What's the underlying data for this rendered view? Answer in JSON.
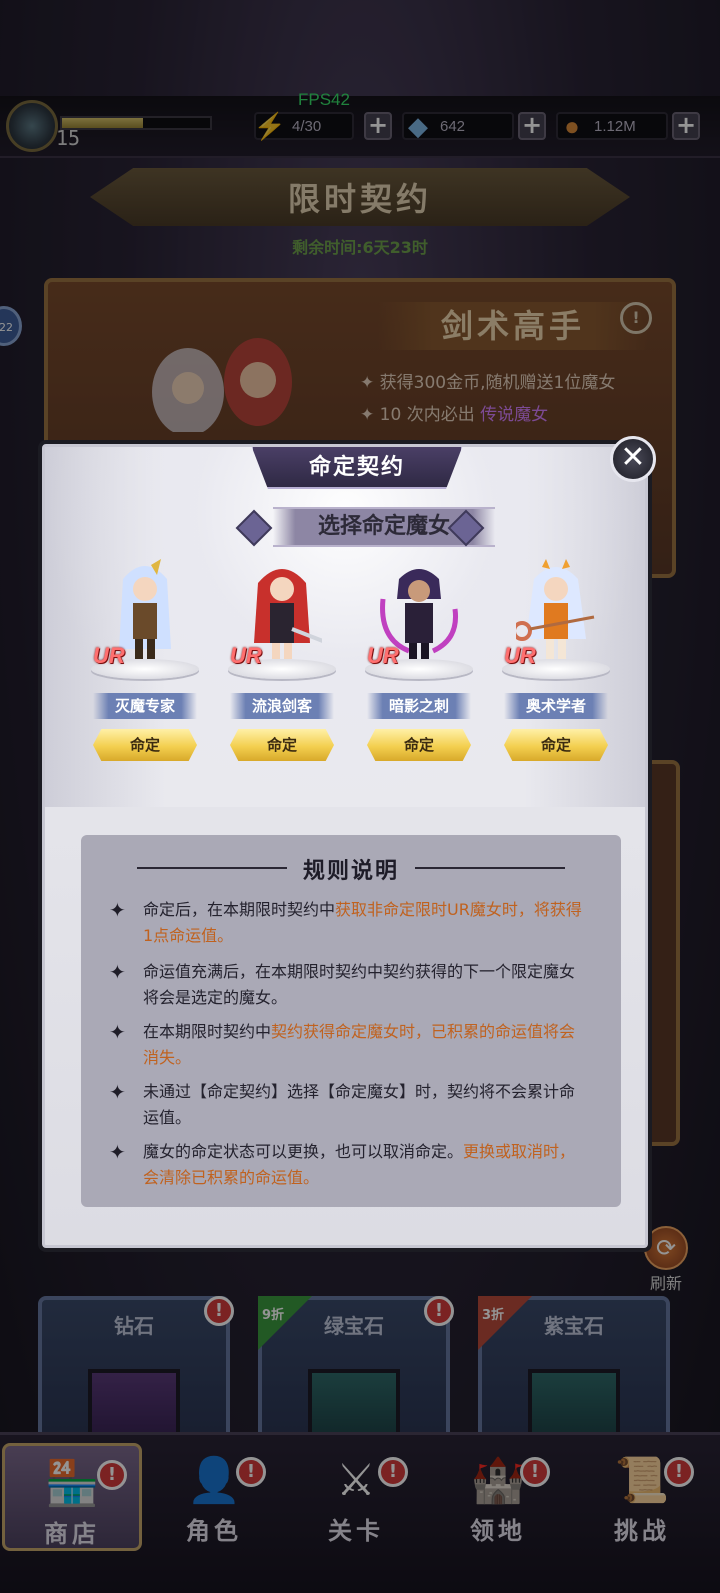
{
  "topbar": {
    "level": "15",
    "exp_fraction": 0.55,
    "fps": "FPS42",
    "energy": "4/30",
    "gems": "642",
    "gold": "1.12M"
  },
  "event": {
    "title": "限时契约",
    "remaining": "剩余时间:6天23时",
    "card_title": "剑术高手",
    "line1": "获得300金币,随机赠送1位魔女",
    "line2_pre": "10 次内必出",
    "line2_hl": "传说魔女",
    "side_badge": "22"
  },
  "modal": {
    "title": "命定契约",
    "subtitle": "选择命定魔女",
    "characters": [
      {
        "rarity": "UR",
        "name": "灭魔专家",
        "button": "命定"
      },
      {
        "rarity": "UR",
        "name": "流浪剑客",
        "button": "命定"
      },
      {
        "rarity": "UR",
        "name": "暗影之刺",
        "button": "命定"
      },
      {
        "rarity": "UR",
        "name": "奥术学者",
        "button": "命定"
      }
    ],
    "rules": {
      "title": "规则说明",
      "items": [
        {
          "plain": "命定后，在本期限时契约中",
          "highlight": "获取非命定限时UR魔女时，将获得1点命运值。"
        },
        {
          "plain": "命运值充满后，在本期限时契约中契约获得的下一个限定魔女将会是选定的魔女。",
          "highlight": ""
        },
        {
          "plain": "在本期限时契约中",
          "highlight": "契约获得命定魔女时，已积累的命运值将会消失。"
        },
        {
          "plain": "未通过【命定契约】选择【命定魔女】时，契约将不会累计命运值。",
          "highlight": ""
        },
        {
          "plain": "魔女的命定状态可以更换，也可以取消命定。",
          "highlight": "更换或取消时，会清除已积累的命运值。"
        }
      ]
    }
  },
  "shop": {
    "refresh": "刷新",
    "cards": [
      {
        "name": "钻石",
        "badge": "",
        "alert": "!"
      },
      {
        "name": "绿宝石",
        "badge": "9折",
        "alert": "!"
      },
      {
        "name": "紫宝石",
        "badge": "3折",
        "alert": ""
      }
    ]
  },
  "nav": {
    "items": [
      {
        "label": "商店",
        "alert": "!"
      },
      {
        "label": "角色",
        "alert": "!"
      },
      {
        "label": "关卡",
        "alert": "!"
      },
      {
        "label": "领地",
        "alert": "!"
      },
      {
        "label": "挑战",
        "alert": "!"
      }
    ]
  },
  "colors": {
    "accent_orange": "#c0621f",
    "legend_purple": "#d680ff",
    "ur_red": "#ff6f6f",
    "button_gold": "#f3cf4f"
  }
}
